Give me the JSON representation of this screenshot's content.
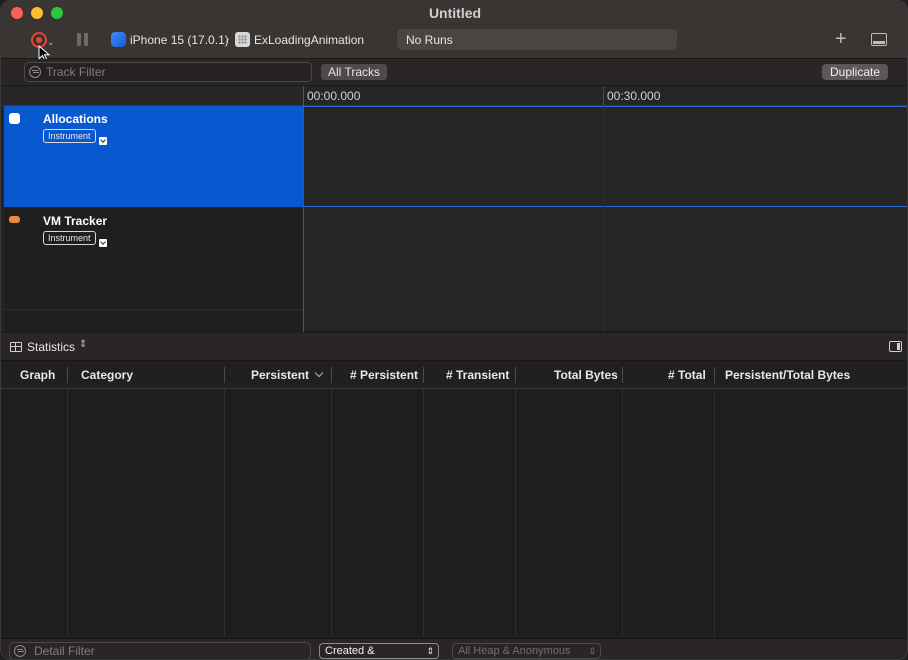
{
  "window": {
    "title": "Untitled"
  },
  "toolbar": {
    "record_icon": "record-icon",
    "pause_icon": "pause-icon",
    "device": "iPhone 15 (17.0.1)",
    "app": "ExLoadingAnimation",
    "runs": "No Runs",
    "add_icon": "plus-icon",
    "panel_icon": "panel-icon"
  },
  "filterbar": {
    "track_filter_placeholder": "Track Filter",
    "all_tracks": "All Tracks",
    "duplicate": "Duplicate"
  },
  "timeline": {
    "ticks": [
      "00:00.000",
      "00:30.000"
    ],
    "tracks": [
      {
        "name": "Allocations",
        "tag": "Instrument",
        "color": "#0859d0",
        "selected": true
      },
      {
        "name": "VM Tracker",
        "tag": "Instrument",
        "color": "#f08a3a",
        "selected": false
      }
    ]
  },
  "detail": {
    "view": "Statistics",
    "columns": [
      "Graph",
      "Category",
      "Persistent",
      "# Persistent",
      "# Transient",
      "Total Bytes",
      "# Total",
      "Persistent/Total Bytes"
    ],
    "rows": []
  },
  "bottombar": {
    "detail_filter_placeholder": "Detail Filter",
    "lifespan": "Created & Persistent",
    "allocation_type": "All Heap & Anonymous VM"
  },
  "colors": {
    "accent": "#0859d0",
    "record": "#e8443a",
    "background": "#1e1e1e"
  }
}
